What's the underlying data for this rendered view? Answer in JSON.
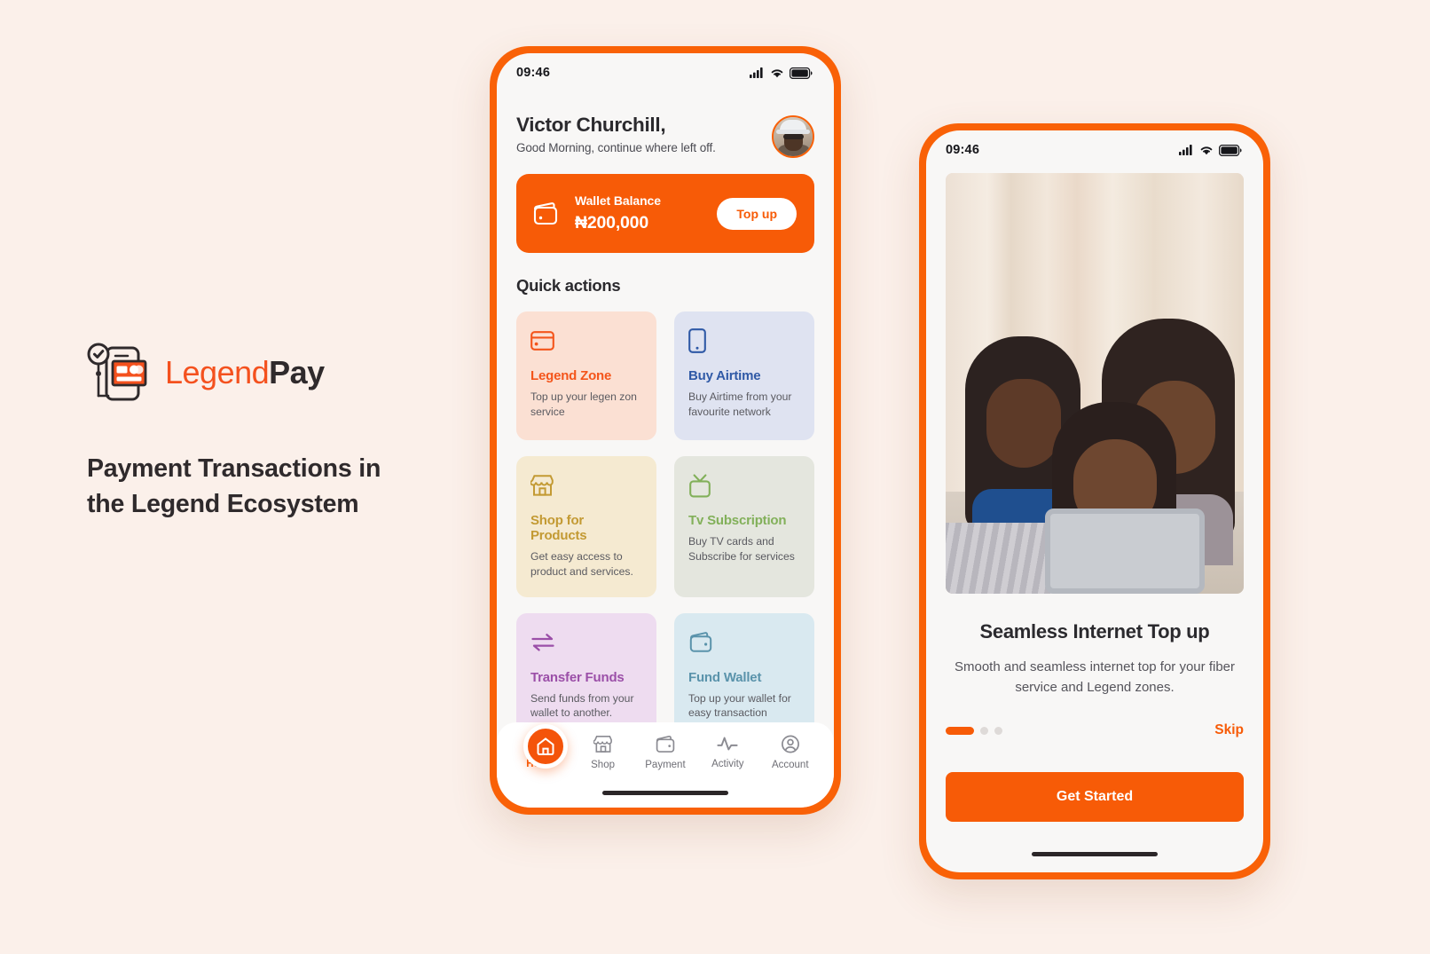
{
  "brand": {
    "name_part1": "Legend",
    "name_part2": "Pay",
    "logo_icon": "phone-card-check-icon"
  },
  "tagline": "Payment Transactions in the Legend Ecosystem",
  "phone_home": {
    "status_bar": {
      "time": "09:46",
      "icons": [
        "cellular-signal-icon",
        "wifi-icon",
        "battery-icon"
      ]
    },
    "greeting": {
      "name": "Victor Churchill,",
      "subtitle": "Good Morning, continue where left off.",
      "avatar_alt": "user-avatar"
    },
    "wallet": {
      "icon": "wallet-icon",
      "label": "Wallet Balance",
      "amount": "₦200,000",
      "topup_label": "Top up"
    },
    "quick_actions_title": "Quick actions",
    "quick_actions": [
      {
        "icon": "credit-card-icon",
        "title": "Legend Zone",
        "desc": "Top up your legen zon service",
        "bg": "#fbe0d3",
        "color": "#f4551b"
      },
      {
        "icon": "mobile-phone-icon",
        "title": "Buy Airtime",
        "desc": "Buy Airtime from your favourite network",
        "bg": "#dfe3f1",
        "color": "#2f59a6"
      },
      {
        "icon": "store-icon",
        "title": "Shop for Products",
        "desc": "Get easy access to product and services.",
        "bg": "#f5ead1",
        "color": "#c39a33"
      },
      {
        "icon": "television-icon",
        "title": "Tv Subscription",
        "desc": "Buy TV cards and Subscribe for services",
        "bg": "#e4e6de",
        "color": "#82b05a"
      },
      {
        "icon": "transfer-arrows-icon",
        "title": "Transfer Funds",
        "desc": "Send funds from your wallet to another.",
        "bg": "#eedcf0",
        "color": "#9b4fa8"
      },
      {
        "icon": "wallet-outline-icon",
        "title": "Fund Wallet",
        "desc": "Top up your wallet for easy transaction",
        "bg": "#d9e9f0",
        "color": "#5a93ab"
      }
    ],
    "bottom_nav": [
      {
        "icon": "home-icon",
        "label": "Home",
        "active": true
      },
      {
        "icon": "store-icon",
        "label": "Shop",
        "active": false
      },
      {
        "icon": "wallet-icon",
        "label": "Payment",
        "active": false
      },
      {
        "icon": "activity-pulse-icon",
        "label": "Activity",
        "active": false
      },
      {
        "icon": "account-circle-icon",
        "label": "Account",
        "active": false
      }
    ]
  },
  "phone_onboarding": {
    "status_bar": {
      "time": "09:46",
      "icons": [
        "cellular-signal-icon",
        "wifi-icon",
        "battery-icon"
      ]
    },
    "hero_alt": "family-with-tablet-photo",
    "title": "Seamless Internet Top up",
    "description": "Smooth and seamless internet top for your fiber service and Legend zones.",
    "pagination": {
      "total": 3,
      "active_index": 0
    },
    "skip_label": "Skip",
    "cta_label": "Get Started"
  },
  "colors": {
    "page_bg": "#fbf0ea",
    "brand_orange": "#f75b07",
    "frame_orange": "#f96107",
    "heading_dark": "#2b2a2e"
  }
}
